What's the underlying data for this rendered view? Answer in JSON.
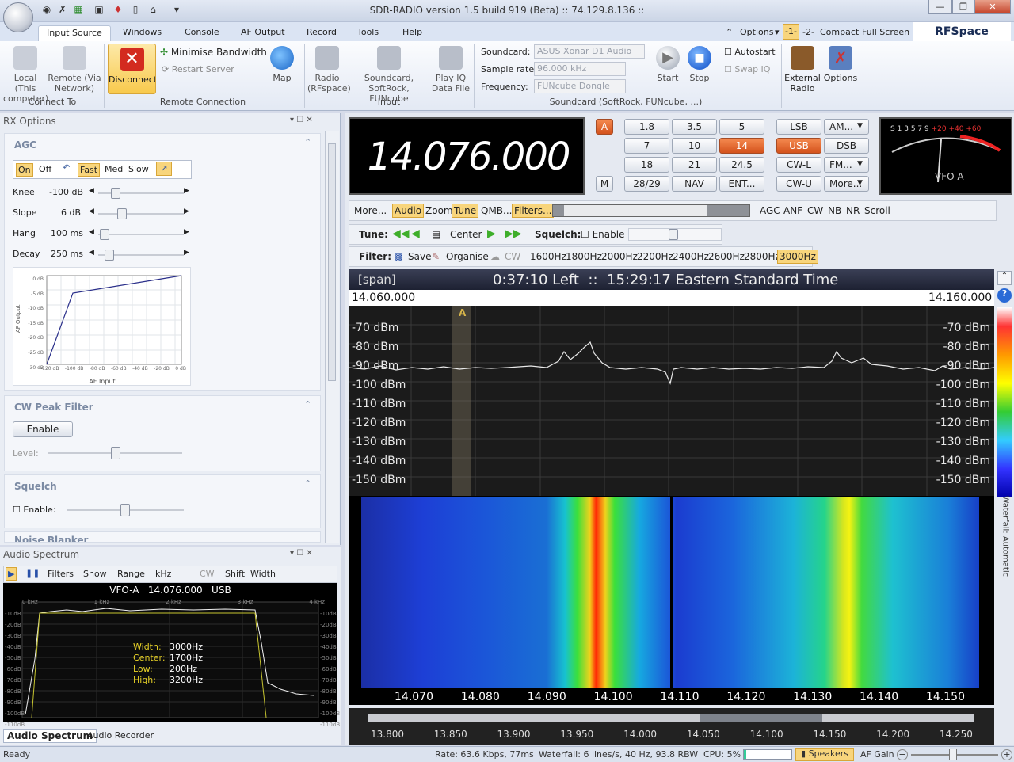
{
  "titlebar": {
    "title": "SDR-RADIO version 1.5 build 919 (Beta) :: 74.129.8.136 ::"
  },
  "tabs": [
    "Input Source",
    "Windows",
    "Console",
    "AF Output",
    "Record",
    "Tools",
    "Help"
  ],
  "rightnav": {
    "options": "Options",
    "one": "-1-",
    "two": "-2-",
    "compact": "Compact",
    "fullscreen": "Full Screen",
    "brand": "RFSpace"
  },
  "ribbon": {
    "local": "Local (This computer)",
    "remote": "Remote (Via Network)",
    "disconnect": "Disconnect",
    "minimise": "Minimise Bandwidth",
    "restart": "Restart Server",
    "map": "Map",
    "radio": "Radio (RFspace)",
    "soundcard_btn": "Soundcard, SoftRock, FUNcube",
    "playiq": "Play IQ Data File",
    "group_connect": "Connect To",
    "group_remote": "Remote Connection",
    "group_input": "Input",
    "group_sound": "Soundcard (SoftRock, FUNcube, ...)",
    "soundcard_lbl": "Soundcard:",
    "soundcard_val": "ASUS Xonar D1 Audio",
    "samplerate_lbl": "Sample rate:",
    "samplerate_val": "96.000 kHz",
    "frequency_lbl": "Frequency:",
    "frequency_val": "FUNcube Dongle",
    "start": "Start",
    "stop": "Stop",
    "autostart": "Autostart",
    "swapiq": "Swap IQ",
    "external": "External Radio",
    "options": "Options"
  },
  "rx": {
    "panel_title": "RX Options",
    "agc_title": "AGC",
    "agc_buttons": [
      "On",
      "Off",
      "Fast",
      "Med",
      "Slow"
    ],
    "rows": [
      {
        "label": "Knee",
        "value": "-100 dB"
      },
      {
        "label": "Slope",
        "value": "6 dB"
      },
      {
        "label": "Hang",
        "value": "100 ms"
      },
      {
        "label": "Decay",
        "value": "250 ms"
      }
    ],
    "graph": {
      "ylabel": "AF Output",
      "xlabel": "AF Input",
      "yticks": [
        "0 dB",
        "-5 dB",
        "-10 dB",
        "-15 dB",
        "-20 dB",
        "-25 dB",
        "-30 dB"
      ],
      "xticks": [
        "-120 dB",
        "-100 dB",
        "-80 dB",
        "-60 dB",
        "-40 dB",
        "-20 dB",
        "0 dB"
      ]
    },
    "cw_title": "CW Peak Filter",
    "cw_enable": "Enable",
    "cw_level": "Level:",
    "squelch_title": "Squelch",
    "squelch_enable": "Enable:",
    "noise_title": "Noise Blanker"
  },
  "audio": {
    "panel_title": "Audio Spectrum",
    "toolbar": [
      "Filters",
      "Show",
      "Range",
      "kHz",
      "CW",
      "Shift",
      "Width"
    ],
    "header": "VFO-A   14.076.000   USB",
    "xticks": [
      "0 kHz",
      "1 kHz",
      "2 kHz",
      "3 kHz",
      "4 kHz"
    ],
    "yticks": [
      "-10dB",
      "-20dB",
      "-30dB",
      "-40dB",
      "-50dB",
      "-60dB",
      "-70dB",
      "-80dB",
      "-90dB",
      "-100dB",
      "-110dB"
    ],
    "info": [
      {
        "k": "Width:",
        "v": "3000Hz"
      },
      {
        "k": "Center:",
        "v": "1700Hz"
      },
      {
        "k": "Low:",
        "v": "200Hz"
      },
      {
        "k": "High:",
        "v": "3200Hz"
      }
    ],
    "tabs": [
      "Audio Spectrum",
      "Audio Recorder"
    ]
  },
  "radio": {
    "frequency": "14.076.000",
    "vfo_a": "A",
    "mem": "M",
    "bands": [
      "1.8",
      "3.5",
      "5",
      "7",
      "10",
      "14",
      "18",
      "21",
      "24.5",
      "28/29",
      "NAV",
      "ENT..."
    ],
    "active_band": "14",
    "modes": [
      "LSB",
      "AM...",
      "USB",
      "DSB",
      "CW-L",
      "FM...",
      "CW-U",
      "More..."
    ],
    "active_mode": "USB",
    "smeter_label": "VFO A",
    "smeter_ticks": [
      "S",
      "1",
      "3",
      "5",
      "7",
      "9",
      "+20",
      "+40",
      "+60"
    ]
  },
  "toolbar1": {
    "items": [
      "More...",
      "Audio",
      "Zoom",
      "Tune",
      "QMB...",
      "Filters..."
    ],
    "right": [
      "AGC",
      "ANF",
      "CW",
      "NB",
      "NR",
      "Scroll"
    ]
  },
  "tune": {
    "label": "Tune:",
    "center": "Center",
    "squelch": "Squelch:",
    "enable": "Enable"
  },
  "filter": {
    "label": "Filter:",
    "save": "Save",
    "organise": "Organise",
    "cw": "CW",
    "widths": [
      "1600Hz",
      "1800Hz",
      "2000Hz",
      "2200Hz",
      "2400Hz",
      "2600Hz",
      "2800Hz",
      "3000Hz"
    ],
    "active": "3000Hz"
  },
  "spectrum": {
    "span": "[span]",
    "status": "0:37:10 Left  ::  15:29:17 Eastern Standard Time",
    "start": "14.060.000",
    "end": "14.160.000",
    "dbm": [
      "-70 dBm",
      "-80 dBm",
      "-90 dBm",
      "-100 dBm",
      "-110 dBm",
      "-120 dBm",
      "-130 dBm",
      "-140 dBm",
      "-150 dBm"
    ],
    "xaxis": [
      "14.070",
      "14.080",
      "14.090",
      "14.100",
      "14.110",
      "14.120",
      "14.130",
      "14.140",
      "14.150"
    ],
    "marker": "A",
    "waterfall_side": "Waterfall: Automatic"
  },
  "overview": {
    "ticks": [
      "13.800",
      "13.850",
      "13.900",
      "13.950",
      "14.000",
      "14.050",
      "14.100",
      "14.150",
      "14.200",
      "14.250"
    ]
  },
  "status": {
    "ready": "Ready",
    "rate": "Rate: 63.6 Kbps, 77ms",
    "waterfall": "Waterfall: 6 lines/s, 40 Hz, 93.8 RBW",
    "cpu": "CPU: 5%",
    "speakers": "Speakers",
    "afgain": "AF Gain"
  }
}
